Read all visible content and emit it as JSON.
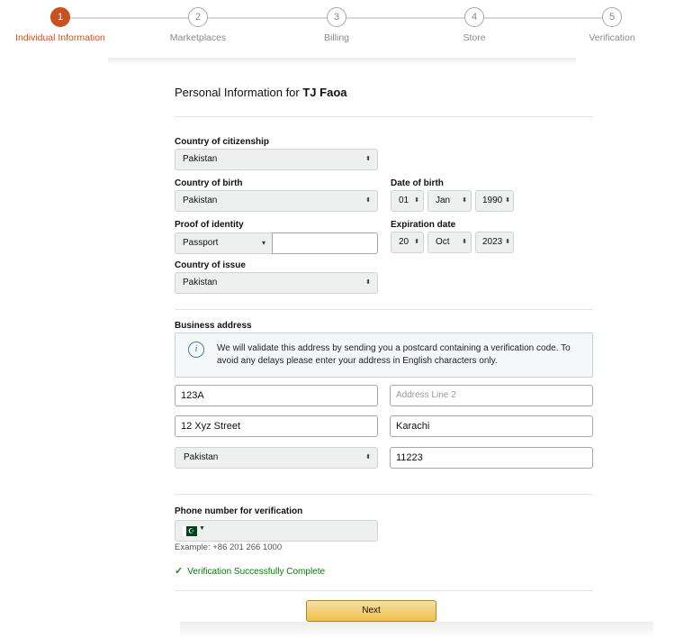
{
  "stepper": {
    "steps": [
      {
        "number": "1",
        "label": "Individual Information"
      },
      {
        "number": "2",
        "label": "Marketplaces"
      },
      {
        "number": "3",
        "label": "Billing"
      },
      {
        "number": "4",
        "label": "Store"
      },
      {
        "number": "5",
        "label": "Verification"
      }
    ],
    "active_index": 0
  },
  "page": {
    "title_prefix": "Personal Information for",
    "title_name": "TJ Faoa"
  },
  "citizenship": {
    "label": "Country of citizenship",
    "value": "Pakistan"
  },
  "birth_country": {
    "label": "Country of birth",
    "value": "Pakistan"
  },
  "dob": {
    "label": "Date of birth",
    "day": "01",
    "month": "Jan",
    "year": "1990"
  },
  "identity": {
    "label": "Proof of identity",
    "value": "Passport",
    "number_value": ""
  },
  "expiration": {
    "label": "Expiration date",
    "day": "20",
    "month": "Oct",
    "year": "2023"
  },
  "issue_country": {
    "label": "Country of issue",
    "value": "Pakistan"
  },
  "address": {
    "label": "Business address",
    "info": "We will validate this address by sending you a postcard containing a verification code. To avoid any delays please enter your address in English characters only.",
    "line1": "123A",
    "line2_placeholder": "Address Line 2",
    "street": "12 Xyz Street",
    "city": "Karachi",
    "country": "Pakistan",
    "postal": "11223"
  },
  "phone": {
    "label": "Phone number for verification",
    "example": "Example: +86 201 266 1000",
    "verified": "Verification Successfully Complete"
  },
  "actions": {
    "next_label": "Next"
  },
  "colors": {
    "accent": "#c7511f",
    "success": "#0a7a0a",
    "button": "#f0c14b"
  }
}
